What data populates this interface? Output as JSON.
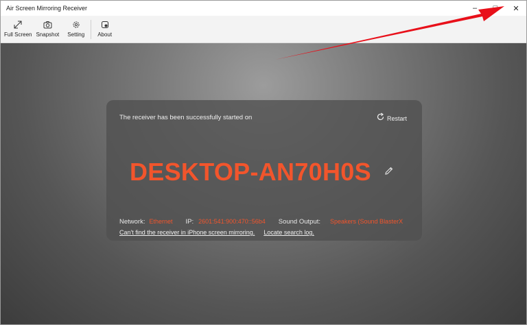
{
  "window": {
    "title": "Air Screen Mirroring Receiver",
    "minimize_glyph": "–",
    "maximize_glyph": "□",
    "close_glyph": "✕"
  },
  "toolbar": {
    "items": [
      {
        "label": "Full Screen",
        "icon": "expand-icon"
      },
      {
        "label": "Snapshot",
        "icon": "camera-icon"
      },
      {
        "label": "Setting",
        "icon": "gear-icon"
      },
      {
        "label": "About",
        "icon": "info-icon"
      }
    ]
  },
  "receiver": {
    "status_message": "The receiver has been successfully started on",
    "restart_label": "Restart",
    "device_name": "DESKTOP-AN70H0S",
    "network_label": "Network:",
    "network_value": "Ethernet",
    "ip_label": "IP:",
    "ip_value": "2601:541:900:470::56b4",
    "sound_label": "Sound Output:",
    "sound_value": "Speakers (Sound BlasterX",
    "help_link": "Can't find the receiver in iPhone screen mirroring.",
    "log_link": "Locate search log."
  },
  "colors": {
    "accent": "#f2552c",
    "annotation_arrow": "#e8101a"
  }
}
